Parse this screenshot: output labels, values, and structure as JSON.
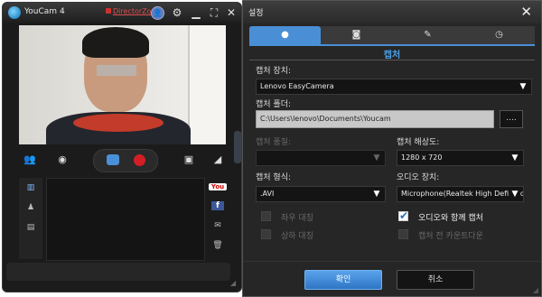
{
  "youcam": {
    "title": "YouCam 4",
    "director_zone": "DirectorZone",
    "icons": [
      "user-icon",
      "gear-icon",
      "minimize-icon",
      "maximize-icon",
      "close-icon"
    ]
  },
  "settings": {
    "title": "설정",
    "tabs": [
      {
        "name": "capture",
        "icon": "circle-icon",
        "glyph": "●"
      },
      {
        "name": "snapshot",
        "icon": "camera-icon",
        "glyph": "◙"
      },
      {
        "name": "tools",
        "icon": "tools-icon",
        "glyph": "✎"
      },
      {
        "name": "schedule",
        "icon": "clock-icon",
        "glyph": "◷"
      }
    ],
    "section_title": "캡처",
    "capture_device_label": "캡처 장치:",
    "capture_device_value": "Lenovo EasyCamera",
    "capture_folder_label": "캡처 폴더:",
    "capture_folder_value": "C:\\Users\\lenovo\\Documents\\Youcam",
    "browse_label": "....",
    "capture_quality_label": "캡처 품질:",
    "capture_quality_value": "",
    "capture_resolution_label": "캡처 해상도:",
    "capture_resolution_value": "1280 x 720",
    "capture_format_label": "캡처 형식:",
    "capture_format_value": ".AVI",
    "audio_device_label": "오디오 장치:",
    "audio_device_value": "Microphone(Realtek High Definition",
    "flip_horizontal_label": "좌우 대칭",
    "flip_vertical_label": "상하 대칭",
    "capture_with_audio_label": "오디오와 함께 캡처",
    "countdown_label": "캡처 전 카운트다운",
    "checkbox_states": {
      "flip_horizontal": false,
      "flip_vertical": false,
      "capture_with_audio": true,
      "countdown": false
    },
    "ok_label": "확인",
    "cancel_label": "취소"
  },
  "colors": {
    "accent": "#4a8fd6",
    "record": "#d21f26",
    "background": "#262626"
  }
}
